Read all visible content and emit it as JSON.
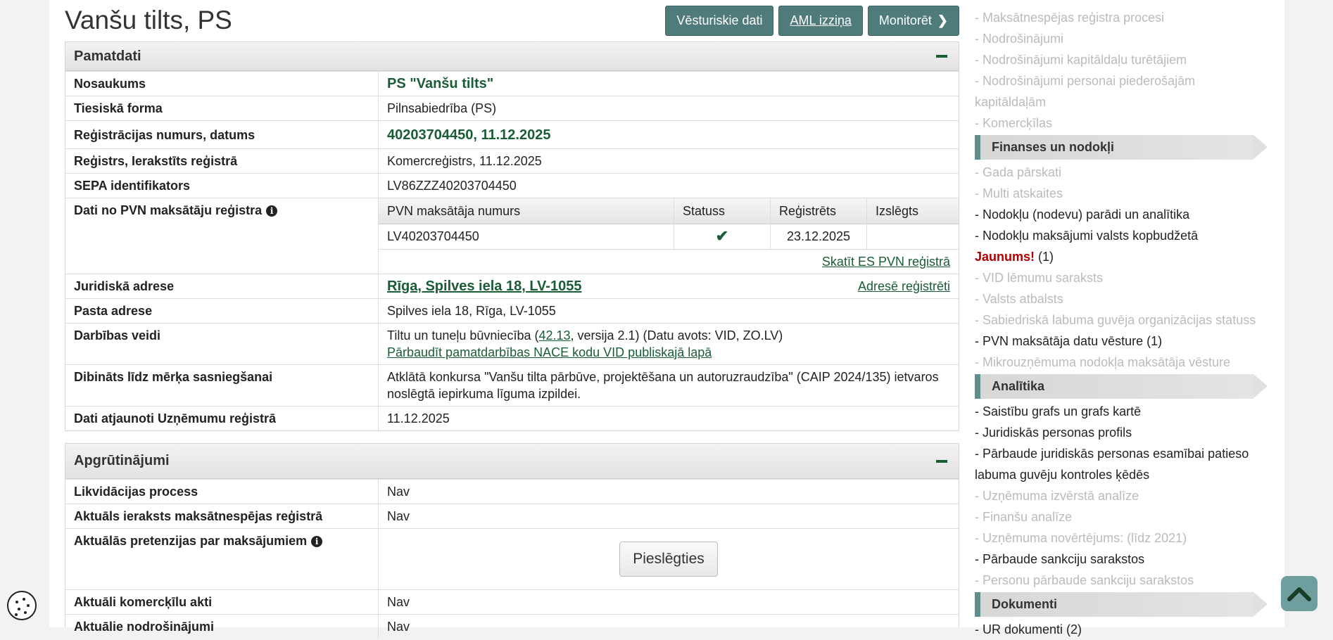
{
  "title": "Vanšu tilts, PS",
  "buttons": {
    "history": "Vēsturiskie dati",
    "aml": "AML izziņa",
    "monitor": "Monitorēt"
  },
  "pamatdati": {
    "heading": "Pamatdati",
    "name_label": "Nosaukums",
    "name": "PS \"Vanšu tilts\"",
    "form_label": "Tiesiskā forma",
    "form": "Pilnsabiedrība (PS)",
    "reg_label": "Reģistrācijas numurs, datums",
    "reg": "40203704450, 11.12.2025",
    "registry_label": "Reģistrs, Ierakstīts reģistrā",
    "registry": "Komercreģistrs, 11.12.2025",
    "sepa_label": "SEPA identifikators",
    "sepa": "LV86ZZZ40203704450",
    "vat_label": "Dati no PVN maksātāju reģistra",
    "vat_headers": [
      "PVN maksātāja numurs",
      "Statuss",
      "Reģistrēts",
      "Izslēgts"
    ],
    "vat_row": {
      "number": "LV40203704450",
      "registered": "23.12.2025",
      "excluded": ""
    },
    "vat_link": "Skatīt ES PVN reģistrā",
    "address_label": "Juridiskā adrese",
    "address": "Rīga, Spilves iela 18, LV-1055",
    "address_link": "Adresē reģistrēti",
    "postal_label": "Pasta adrese",
    "postal": "Spilves iela 18, Rīga, LV-1055",
    "activity_label": "Darbības veidi",
    "activity_pre": "Tiltu un tuneļu būvniecība (",
    "activity_code": "42.13",
    "activity_post": ", versija 2.1) (Datu avots: VID, ZO.LV)",
    "activity_link": "Pārbaudīt pamatdarbības NACE kodu VID publiskajā lapā",
    "purpose_label": "Dibināts līdz mērķa sasniegšanai",
    "purpose": "Atklātā konkursa \"Vanšu tilta pārbūve, projektēšana un autoruzraudzība\" (CAIP 2024/135) ietvaros noslēgtā iepirkuma līguma izpildei.",
    "updated_label": "Dati atjaunoti Uzņēmumu reģistrā",
    "updated": "11.12.2025"
  },
  "encumbrances": {
    "heading": "Apgrūtinājumi",
    "liq_label": "Likvidācijas process",
    "liq": "Nav",
    "insolv_label": "Aktuāls ieraksts maksātnespējas reģistrā",
    "insolv": "Nav",
    "claims_label": "Aktuālās pretenzijas par maksājumiem",
    "connect": "Pieslēgties",
    "pledge_label": "Aktuāli komercķīlu akti",
    "pledge": "Nav",
    "secur_label": "Aktuālie nodrošinājumi",
    "secur": "Nav"
  },
  "sidebar": {
    "top_items": [
      {
        "label": "- Maksātnespējas reģistra procesi"
      },
      {
        "label": "- Nodrošinājumi"
      },
      {
        "label": "- Nodrošinājumi kapitāldaļu turētājiem"
      },
      {
        "label": "- Nodrošinājumi personai piederošajām kapitāldaļām"
      },
      {
        "label": "- Komercķīlas"
      }
    ],
    "finance_heading": "Finanses un nodokļi",
    "finance_items": [
      {
        "label": "- Gada pārskati",
        "active": false
      },
      {
        "label": "- Multi atskaites",
        "active": false
      },
      {
        "label": "- Nodokļu (nodevu) parādi un analītika",
        "active": true
      },
      {
        "label": "- Nodokļu maksājumi valsts kopbudžetā",
        "active": true
      }
    ],
    "new_label": "Jaunums!",
    "new_count": "(1)",
    "finance_items2": [
      {
        "label": "- VID lēmumu saraksts",
        "active": false
      },
      {
        "label": "- Valsts atbalsts",
        "active": false
      },
      {
        "label": "- Sabiedriskā labuma guvēja organizācijas statuss",
        "active": false
      },
      {
        "label": "- PVN maksātāja datu vēsture (1)",
        "active": true
      },
      {
        "label": "- Mikrouzņēmuma nodokļa maksātāja vēsture",
        "active": false
      }
    ],
    "analytics_heading": "Analītika",
    "analytics_items": [
      {
        "label": "- Saistību grafs un grafs kartē",
        "active": true
      },
      {
        "label": "- Juridiskās personas profils",
        "active": true
      },
      {
        "label": "- Pārbaude juridiskās personas esamībai patieso labuma guvēju kontroles ķēdēs",
        "active": true
      },
      {
        "label": "- Uzņēmuma izvērstā analīze",
        "active": false
      },
      {
        "label": "- Finanšu analīze",
        "active": false
      },
      {
        "label": "- Uzņēmuma novērtējums: (līdz 2021)",
        "active": false
      },
      {
        "label": "- Pārbaude sankciju sarakstos",
        "active": true
      },
      {
        "label": "- Personu pārbaude sankciju sarakstos",
        "active": false
      }
    ],
    "docs_heading": "Dokumenti",
    "docs_item": "- UR dokumenti (2)"
  }
}
